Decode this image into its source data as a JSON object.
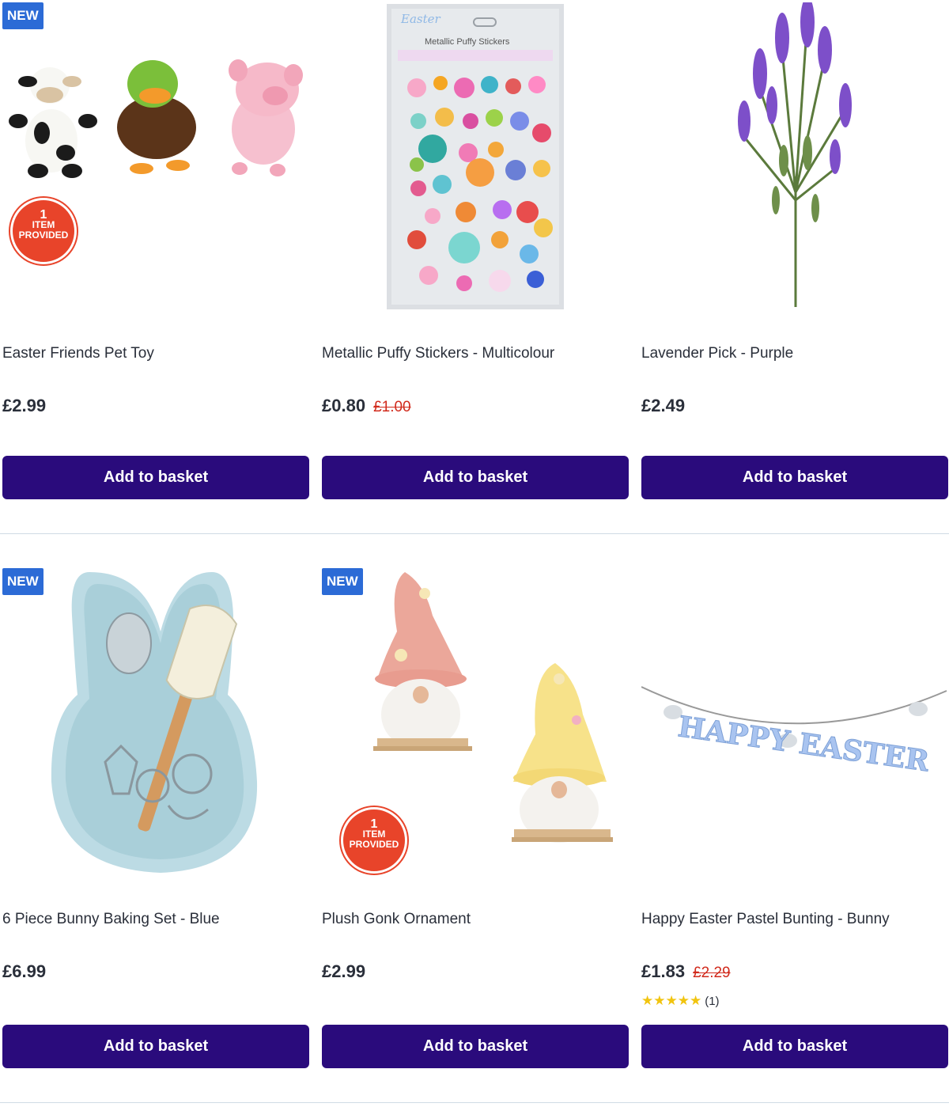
{
  "colors": {
    "button": "#2a0b7c",
    "badge": "#2c6bd6",
    "sale": "#d12a1c",
    "seal": "#e8442a",
    "star": "#f1c40f"
  },
  "products": [
    {
      "name": "Easter Friends Pet Toy",
      "price": "£2.99",
      "was": "",
      "badge": "NEW",
      "seal": {
        "num": "1",
        "text1": "ITEM",
        "text2": "PROVIDED"
      },
      "button": "Add to basket"
    },
    {
      "name": "Metallic Puffy Stickers - Multicolour",
      "price": "£0.80",
      "was": "£1.00",
      "button": "Add to basket",
      "pack_title": "Metallic Puffy Stickers",
      "pack_script": "Easter"
    },
    {
      "name": "Lavender Pick - Purple",
      "price": "£2.49",
      "was": "",
      "button": "Add to basket"
    },
    {
      "name": "6 Piece Bunny Baking Set - Blue",
      "price": "£6.99",
      "was": "",
      "badge": "NEW",
      "button": "Add to basket"
    },
    {
      "name": "Plush Gonk Ornament",
      "price": "£2.99",
      "was": "",
      "badge": "NEW",
      "seal": {
        "num": "1",
        "text1": "ITEM",
        "text2": "PROVIDED"
      },
      "button": "Add to basket"
    },
    {
      "name": "Happy Easter Pastel Bunting - Bunny",
      "price": "£1.83",
      "was": "£2.29",
      "rating": {
        "stars": "★★★★★",
        "value": 5,
        "count": "(1)"
      },
      "button": "Add to basket",
      "bunting_text": "HAPPY EASTER"
    }
  ]
}
